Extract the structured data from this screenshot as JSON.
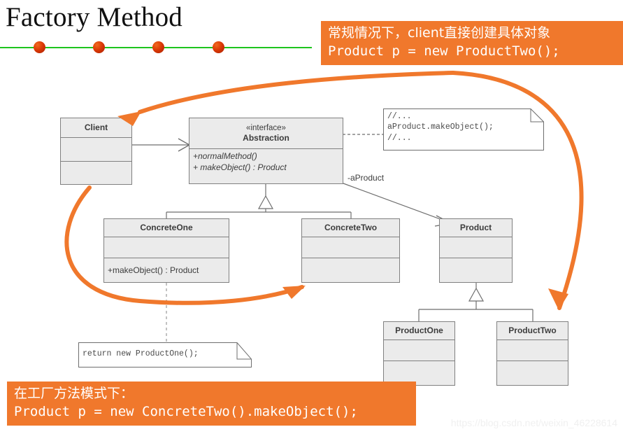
{
  "slide": {
    "title": "Factory Method",
    "watermark": "https://blog.csdn.net/weixin_46228614",
    "accent_orange": "#f0782c",
    "rule_green": "#1ec41e",
    "box_fill": "#ebebeb",
    "box_border": "#808080",
    "text_gray": "#3c3c3c"
  },
  "title_dots": [
    {
      "name": "title-dot-1"
    },
    {
      "name": "title-dot-2"
    },
    {
      "name": "title-dot-3"
    },
    {
      "name": "title-dot-4"
    }
  ],
  "callouts": {
    "top_right": {
      "line1": "常规情况下，client直接创建具体对象",
      "line2": "Product p = new ProductTwo();"
    },
    "bottom_left": {
      "line1": "在工厂方法模式下：",
      "line2": "Product p = new ConcreteTwo().makeObject();"
    }
  },
  "classes": {
    "client": {
      "name": "Client",
      "stereotype": "",
      "ops": ""
    },
    "abstraction": {
      "name": "Abstraction",
      "stereotype": "«interface»",
      "op1": "+normalMethod()",
      "op2": "+ makeObject() : Product"
    },
    "concrete_one": {
      "name": "ConcreteOne",
      "stereotype": "",
      "ops": "+makeObject() : Product"
    },
    "concrete_two": {
      "name": "ConcreteTwo",
      "stereotype": "",
      "ops": ""
    },
    "product": {
      "name": "Product",
      "stereotype": "",
      "ops": ""
    },
    "product_one": {
      "name": "ProductOne",
      "stereotype": "",
      "ops": ""
    },
    "product_two": {
      "name": "ProductTwo",
      "stereotype": "",
      "ops": ""
    }
  },
  "notes": {
    "abstraction_note": "//...\naProduct.makeObject();\n//...",
    "concrete_one_note": "return new ProductOne();"
  },
  "edge_labels": {
    "a_product": "-aProduct"
  }
}
